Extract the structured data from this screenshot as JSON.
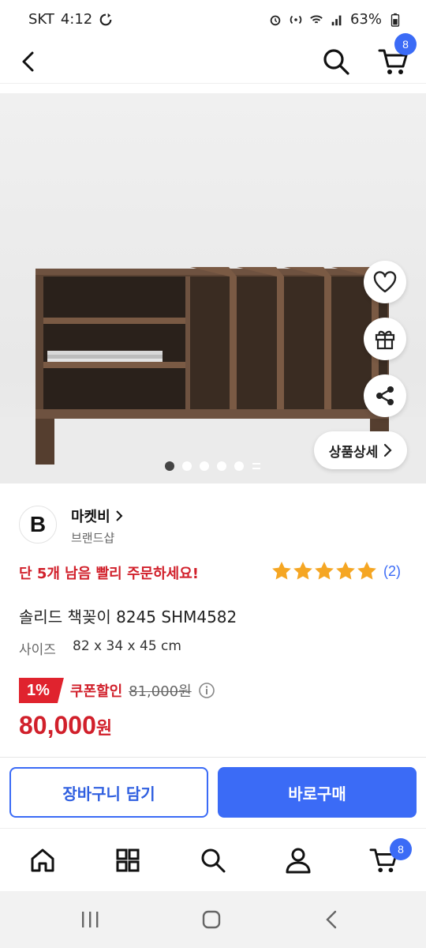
{
  "status_bar": {
    "carrier": "SKT",
    "time": "4:12",
    "battery": "63%"
  },
  "app_bar": {
    "cart_count": "8"
  },
  "hero": {
    "detail_button_label": "상품상세",
    "carousel_pages": 5,
    "active_page": 1
  },
  "brand": {
    "logo_letter": "B",
    "name": "마켓비",
    "sub": "브랜드샵"
  },
  "product": {
    "stock_alert": "단 5개 남음 빨리 주문하세요!",
    "rating": 5,
    "review_count": "(2)",
    "title": "솔리드 책꽂이 8245 SHM4582",
    "size_label": "사이즈",
    "size_value": "82 x 34 x 45 cm",
    "discount_rate": "1%",
    "coupon_label": "쿠폰할인",
    "original_price": "81,000원",
    "price": "80,000",
    "price_unit": "원"
  },
  "actions": {
    "cart_label": "장바구니 담기",
    "buy_label": "바로구매"
  },
  "bottom_nav": {
    "cart_count": "8"
  },
  "colors": {
    "accent": "#3b6bf6",
    "sale": "#d1202b",
    "star": "#f5a623"
  }
}
